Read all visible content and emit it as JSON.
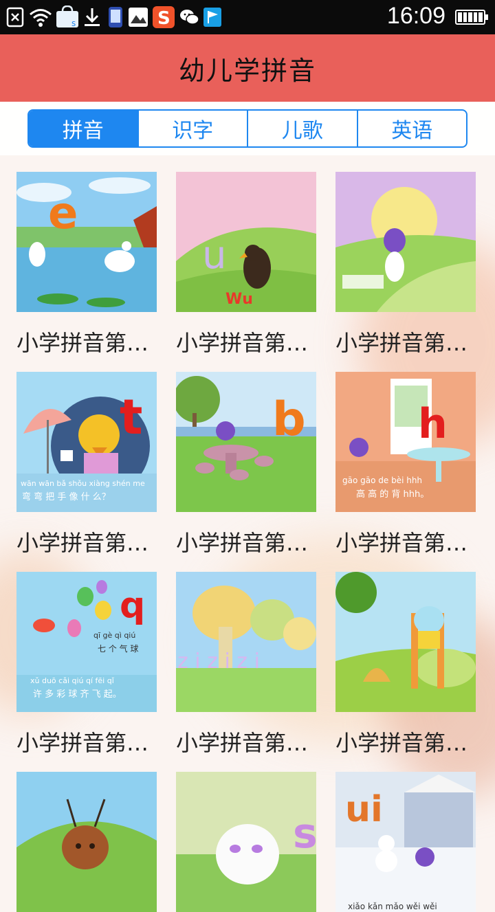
{
  "status_bar": {
    "time": "16:09",
    "icons": [
      "close-box-icon",
      "wifi-icon",
      "shop-bag-icon",
      "download-icon",
      "phone-icon",
      "gallery-icon",
      "sogou-icon",
      "wechat-icon",
      "flag-icon"
    ],
    "shop_bag_letter": "s",
    "sogou_letter": "S",
    "battery_level": 1.0
  },
  "header": {
    "title": "幼儿学拼音"
  },
  "tabs": [
    {
      "label": "拼音",
      "active": true
    },
    {
      "label": "识字",
      "active": false
    },
    {
      "label": "儿歌",
      "active": false
    },
    {
      "label": "英语",
      "active": false
    }
  ],
  "items": [
    {
      "title": "小学拼音第…",
      "letter": "e",
      "scene": "lake-geese"
    },
    {
      "title": "小学拼音第…",
      "letter": "u",
      "caption": "Wu",
      "scene": "crow-field"
    },
    {
      "title": "小学拼音第…",
      "letter": "",
      "scene": "sunrise-cat"
    },
    {
      "title": "小学拼音第…",
      "letter": "t",
      "pinyin": "wān wān bǎ shǒu xiàng shén me",
      "hanzi": "弯 弯 把 手 像 什 么？",
      "scene": "umbrella-duck"
    },
    {
      "title": "小学拼音第…",
      "letter": "b",
      "scene": "garden-table"
    },
    {
      "title": "小学拼音第…",
      "letter": "h",
      "pinyin": "gāo gāo de bèi hhh",
      "hanzi": "高 高 的 背 hhh。",
      "scene": "room-table"
    },
    {
      "title": "小学拼音第…",
      "letter": "q",
      "pinyin1": "qī gè qì qiú",
      "hanzi1": "七 个 气 球",
      "pinyin2": "xǔ duō cǎi qiú qí fēi qǐ",
      "hanzi2": "许 多 彩 球 齐 飞 起。",
      "scene": "balloons"
    },
    {
      "title": "小学拼音第…",
      "letter": "",
      "pinyin": "z i z i z i",
      "scene": "mushrooms"
    },
    {
      "title": "小学拼音第…",
      "letter": "",
      "scene": "mouse-chair"
    },
    {
      "title": "小学拼音第…",
      "letter": "",
      "scene": "ant-hill"
    },
    {
      "title": "小学拼音第…",
      "letter": "s",
      "scene": "white-mouse"
    },
    {
      "title": "小学拼音第…",
      "letter": "ui",
      "pinyin": "xiǎo kǎn mǎo wěi wěi",
      "scene": "snow-village"
    }
  ]
}
